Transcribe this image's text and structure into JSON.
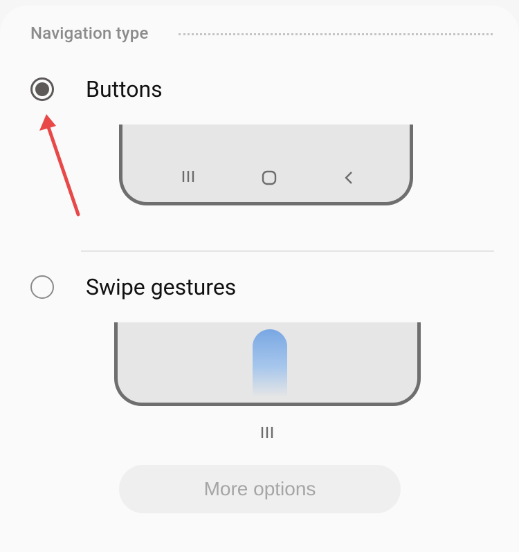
{
  "section": {
    "title": "Navigation type"
  },
  "options": [
    {
      "label": "Buttons",
      "selected": true
    },
    {
      "label": "Swipe gestures",
      "selected": false
    }
  ],
  "buttons_preview": {
    "icons": [
      "recents-icon",
      "home-icon",
      "back-icon"
    ]
  },
  "gestures_preview": {
    "hint_icon": "recents-hint-icon"
  },
  "more_options": {
    "label": "More options"
  },
  "colors": {
    "accent_arrow": "#e84848",
    "radio_selected": "#5d5959",
    "gesture_pill": "#79a7e3"
  }
}
